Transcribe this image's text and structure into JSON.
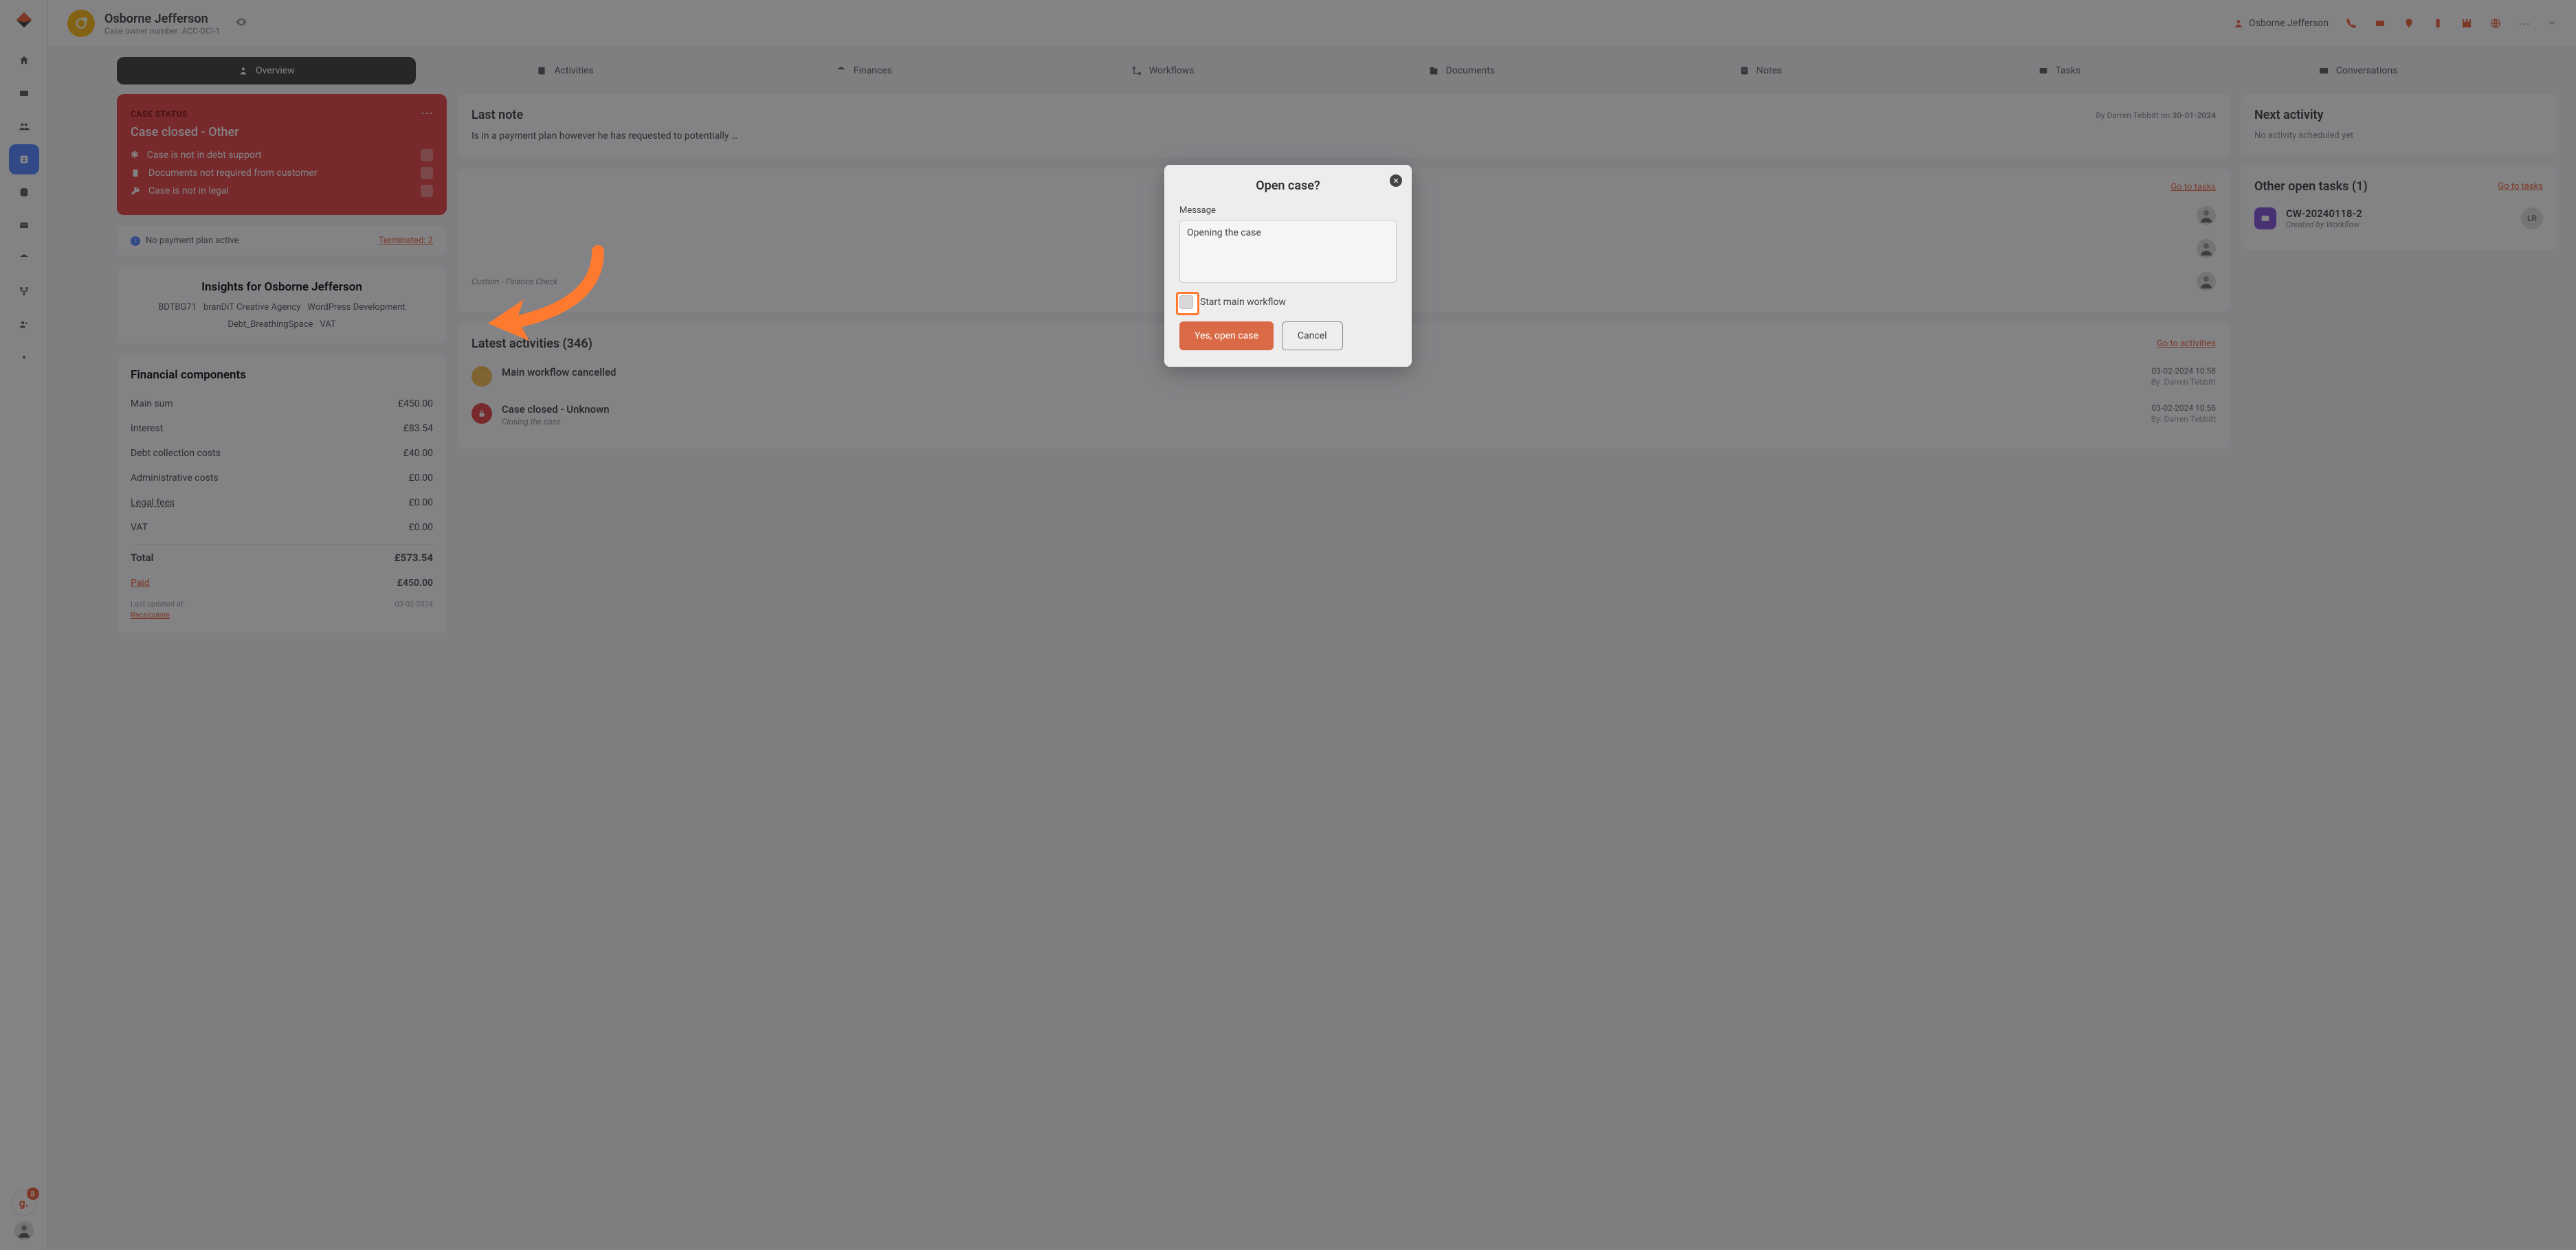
{
  "header": {
    "name": "Osborne Jefferson",
    "subtitle": "Case owner number: ACC-DCI-1",
    "top_user": "Osborne Jefferson"
  },
  "tabs": [
    "Overview",
    "Activities",
    "Finances",
    "Workflows",
    "Documents",
    "Notes",
    "Tasks",
    "Conversations"
  ],
  "status": {
    "label": "CASE STATUS",
    "value": "Case closed - Other",
    "rows": [
      "Case is not in debt support",
      "Documents not required from customer",
      "Case is not in legal"
    ]
  },
  "plan": {
    "text": "No payment plan active",
    "terminated": "Terminated: 2"
  },
  "insights": {
    "title": "Insights for Osborne Jefferson",
    "tags": [
      "BDTBG71",
      "branDiT Creative Agency",
      "WordPress Development",
      "Debt_BreathingSpace",
      "VAT"
    ]
  },
  "financial": {
    "title": "Financial components",
    "rows": [
      {
        "label": "Main sum",
        "value": "£450.00"
      },
      {
        "label": "Interest",
        "value": "£83.54"
      },
      {
        "label": "Debt collection costs",
        "value": "£40.00"
      },
      {
        "label": "Administrative costs",
        "value": "£0.00"
      },
      {
        "label": "Legal fees",
        "value": "£0.00",
        "link": true
      },
      {
        "label": "VAT",
        "value": "£0.00"
      }
    ],
    "total_label": "Total",
    "total_value": "£573.54",
    "paid_label": "Paid",
    "paid_value": "£450.00",
    "updated_label": "Last updated at:",
    "updated_value": "03-02-2024",
    "recalculate": "Recalculate"
  },
  "last_note": {
    "title": "Last note",
    "by": "By Darren Tebbitt on",
    "date": "30-01-2024",
    "body": "Is in a payment plan however he has requested to potentially …"
  },
  "next_activity": {
    "title": "Next activity",
    "empty": "No activity scheduled yet"
  },
  "right_tasks": {
    "title": "Other open tasks (1)",
    "link": "Go to tasks",
    "items": [
      {
        "title": "CW-20240118-2",
        "sub": "Created by Workflow",
        "avatar": "LR"
      }
    ]
  },
  "mid_tasks": {
    "link": "Go to tasks",
    "finance_sub": "Custom - Finance Check"
  },
  "activities": {
    "title": "Latest activities (346)",
    "link": "Go to activities",
    "items": [
      {
        "title": "Main workflow cancelled",
        "sub": "",
        "time": "03-02-2024 10:58",
        "by": "By: Darren Tebbitt",
        "color": "yellow"
      },
      {
        "title": "Case closed - Unknown",
        "sub": "Closing the case",
        "time": "03-02-2024 10:56",
        "by": "By: Darren Tebbitt",
        "color": "red"
      }
    ]
  },
  "modal": {
    "title": "Open case?",
    "message_label": "Message",
    "message_value": "Opening the case",
    "checkbox_label": "Start main workflow",
    "confirm": "Yes, open case",
    "cancel": "Cancel"
  },
  "g_count": "8"
}
